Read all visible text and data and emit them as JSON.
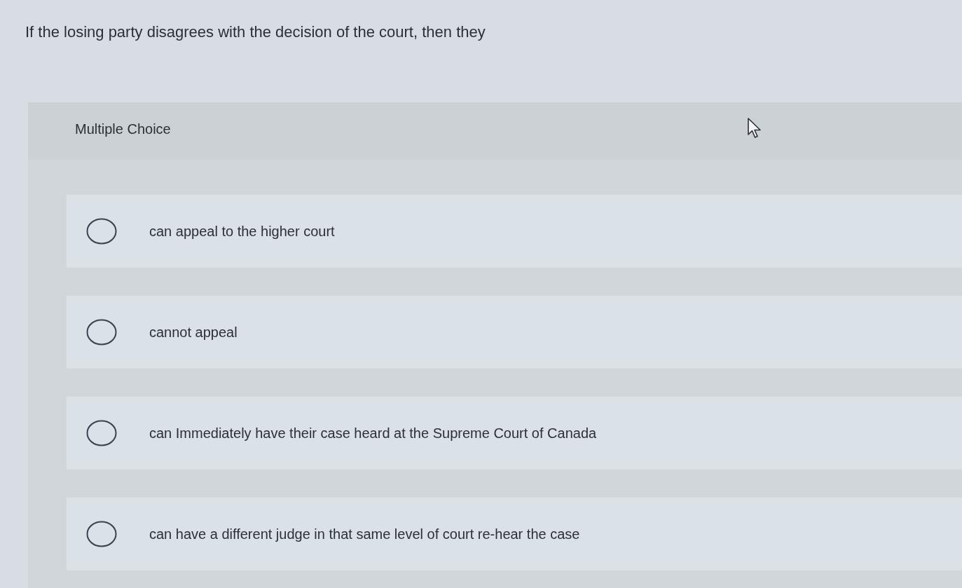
{
  "question": {
    "text": "If the losing party disagrees with the decision of the court, then they"
  },
  "panel": {
    "heading": "Multiple Choice"
  },
  "options": [
    {
      "label": "can appeal to the higher court",
      "selected": false
    },
    {
      "label": "cannot appeal",
      "selected": false
    },
    {
      "label": "can Immediately have their case heard at the Supreme Court of Canada",
      "selected": false
    },
    {
      "label": "can have a different judge in that same level of court re-hear the case",
      "selected": false
    }
  ]
}
